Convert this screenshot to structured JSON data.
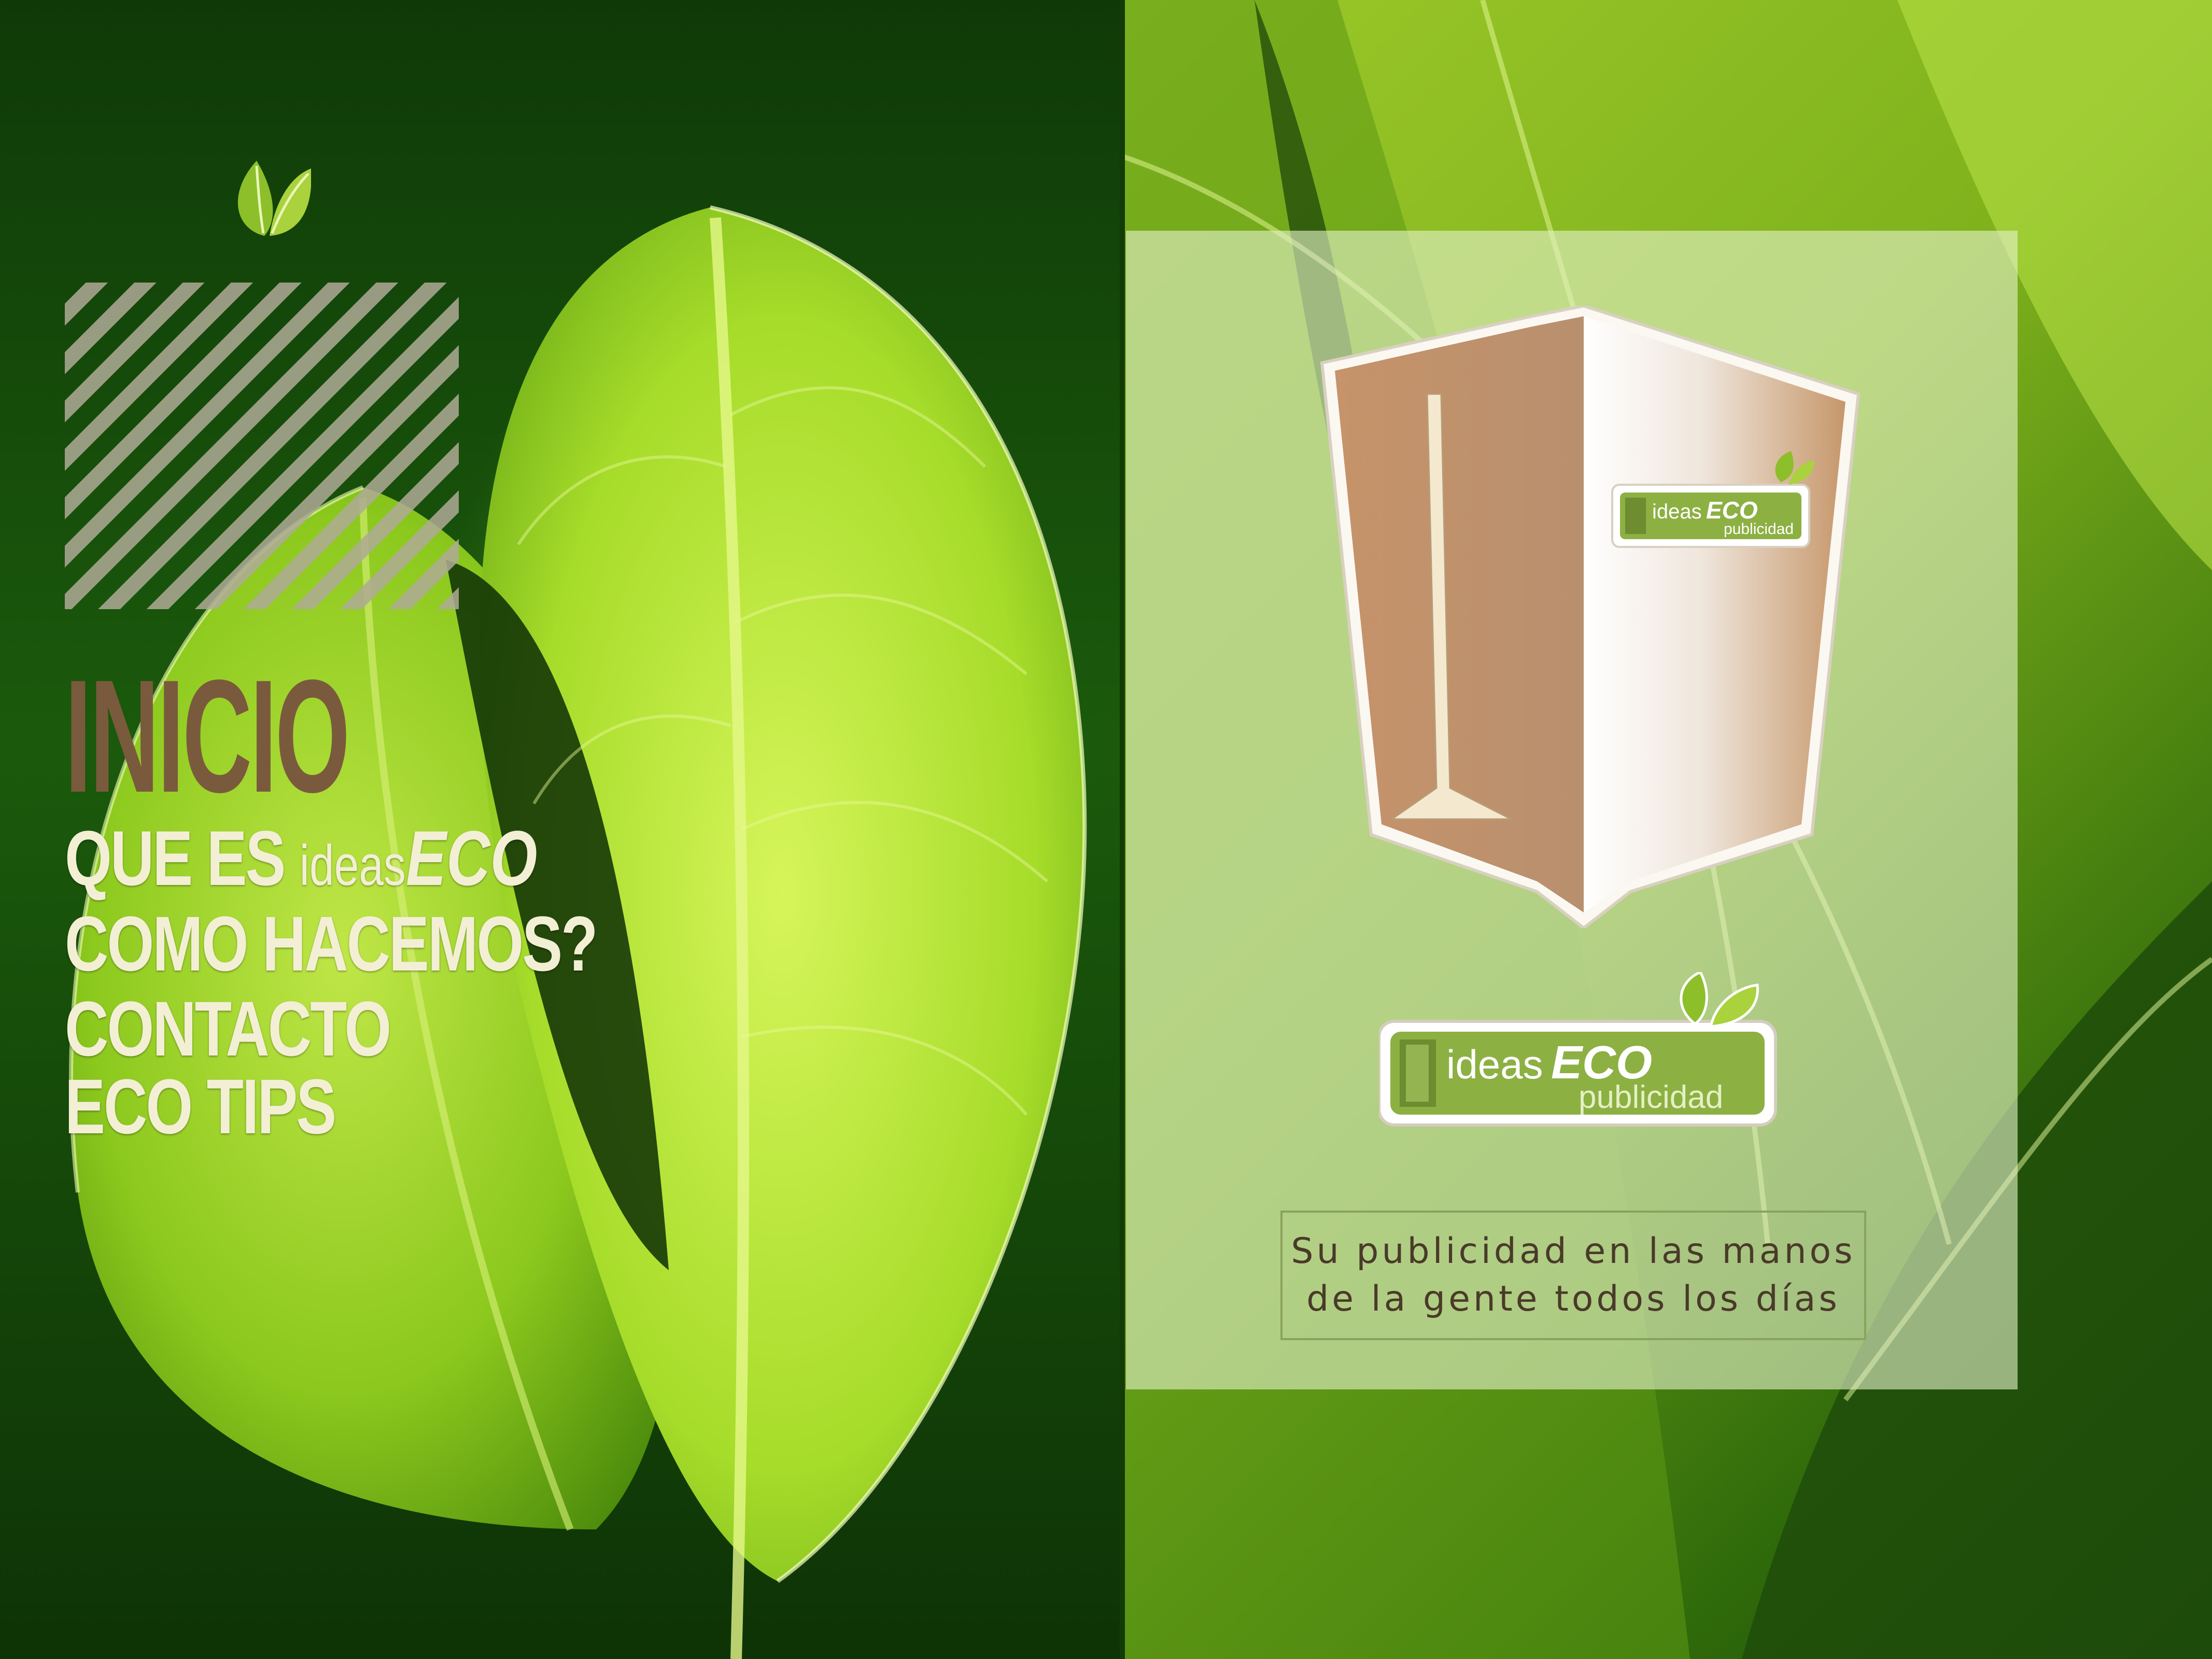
{
  "nav": {
    "items": [
      {
        "label": "INICIO"
      },
      {
        "prefix": "QUE ES ",
        "logo_ideas": "ideas",
        "logo_eco": "ECO"
      },
      {
        "label": "COMO HACEMOS?"
      },
      {
        "label": "CONTACTO"
      },
      {
        "label": "ECO TIPS"
      }
    ]
  },
  "cup_label": {
    "ideas": "ideas",
    "eco": "ECO",
    "sub": "publicidad"
  },
  "logo": {
    "ideas": "ideas",
    "eco": "ECO",
    "sub": "publicidad"
  },
  "tagline": {
    "line1": "Su publicidad en las manos",
    "line2": "de la gente todos los días"
  },
  "colors": {
    "active_nav": "#7a5a3c",
    "nav_text": "#f3efd5",
    "leaf_green": "#8cbf2a",
    "tagline_border": "#8aa25c"
  },
  "icons": [
    "leaf-icon",
    "paper-cup-icon",
    "ideas-eco-logo"
  ]
}
